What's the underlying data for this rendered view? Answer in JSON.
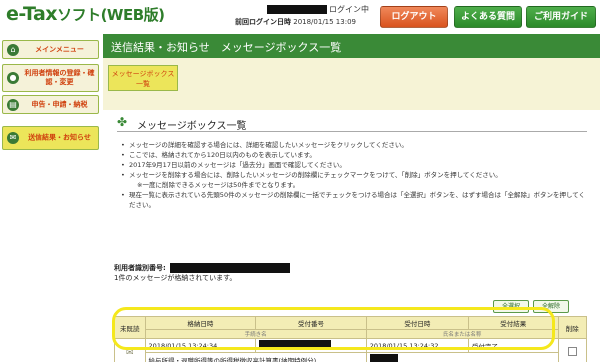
{
  "header": {
    "logo_main": "e-Tax",
    "logo_sub": "ソフト(WEB版)",
    "login_status": "ログイン中",
    "last_login_label": "前回ログイン日時",
    "last_login_value": "2018/01/15 13:09",
    "logout_button": "ログアウト",
    "faq_button": "よくある質問",
    "guide_button": "ご利用ガイド"
  },
  "sidebar": {
    "items": [
      {
        "label": "メインメニュー"
      },
      {
        "label": "利用者情報の登録・確認・変更"
      },
      {
        "label": "申告・申請・納税"
      },
      {
        "label": "送信結果・お知らせ"
      }
    ]
  },
  "main": {
    "title": "送信結果・お知らせ　メッセージボックス一覧",
    "active_tab": "メッセージボックス一覧",
    "section_title": "メッセージボックス一覧",
    "bullets": [
      "メッセージの詳細を確認する場合には、詳細を確認したいメッセージをクリックしてください。",
      "ここでは、格納されてから120日以内のものを表示しています。",
      "2017年9月17日以前のメッセージは「過去分」画面で確認してください。",
      "メッセージを削除する場合には、削除したいメッセージの削除欄にチェックマークをつけて、「削除」ボタンを押してください。",
      "※一度に削除できるメッセージは50件までとなります。",
      "現在一覧に表示されている先頭50件のメッセージの削除欄に一括でチェックをつける場合は「全選択」ボタンを、はずす場合は「全解除」ボタンを押してください。"
    ],
    "user_id_label": "利用者識別番号:",
    "message_count": "1件のメッセージが格納されています。",
    "select_all": "全選択",
    "deselect_all": "全解除"
  },
  "table": {
    "col_unread": "未既読",
    "col_stored_at": "格納日時",
    "col_receipt_no": "受付番号",
    "col_received_at": "受付日時",
    "col_result": "受付結果",
    "col_delete": "削除",
    "sub_procedure": "手続き名",
    "sub_name": "氏名または名称",
    "rows": [
      {
        "stored_at": "2018/01/15 13:24:34",
        "received_at": "2018/01/15 13:24:32",
        "result": "受付完了",
        "procedure": "給与所得・退職所得等の所得税徴収高計算書(納期特例分)"
      }
    ]
  }
}
